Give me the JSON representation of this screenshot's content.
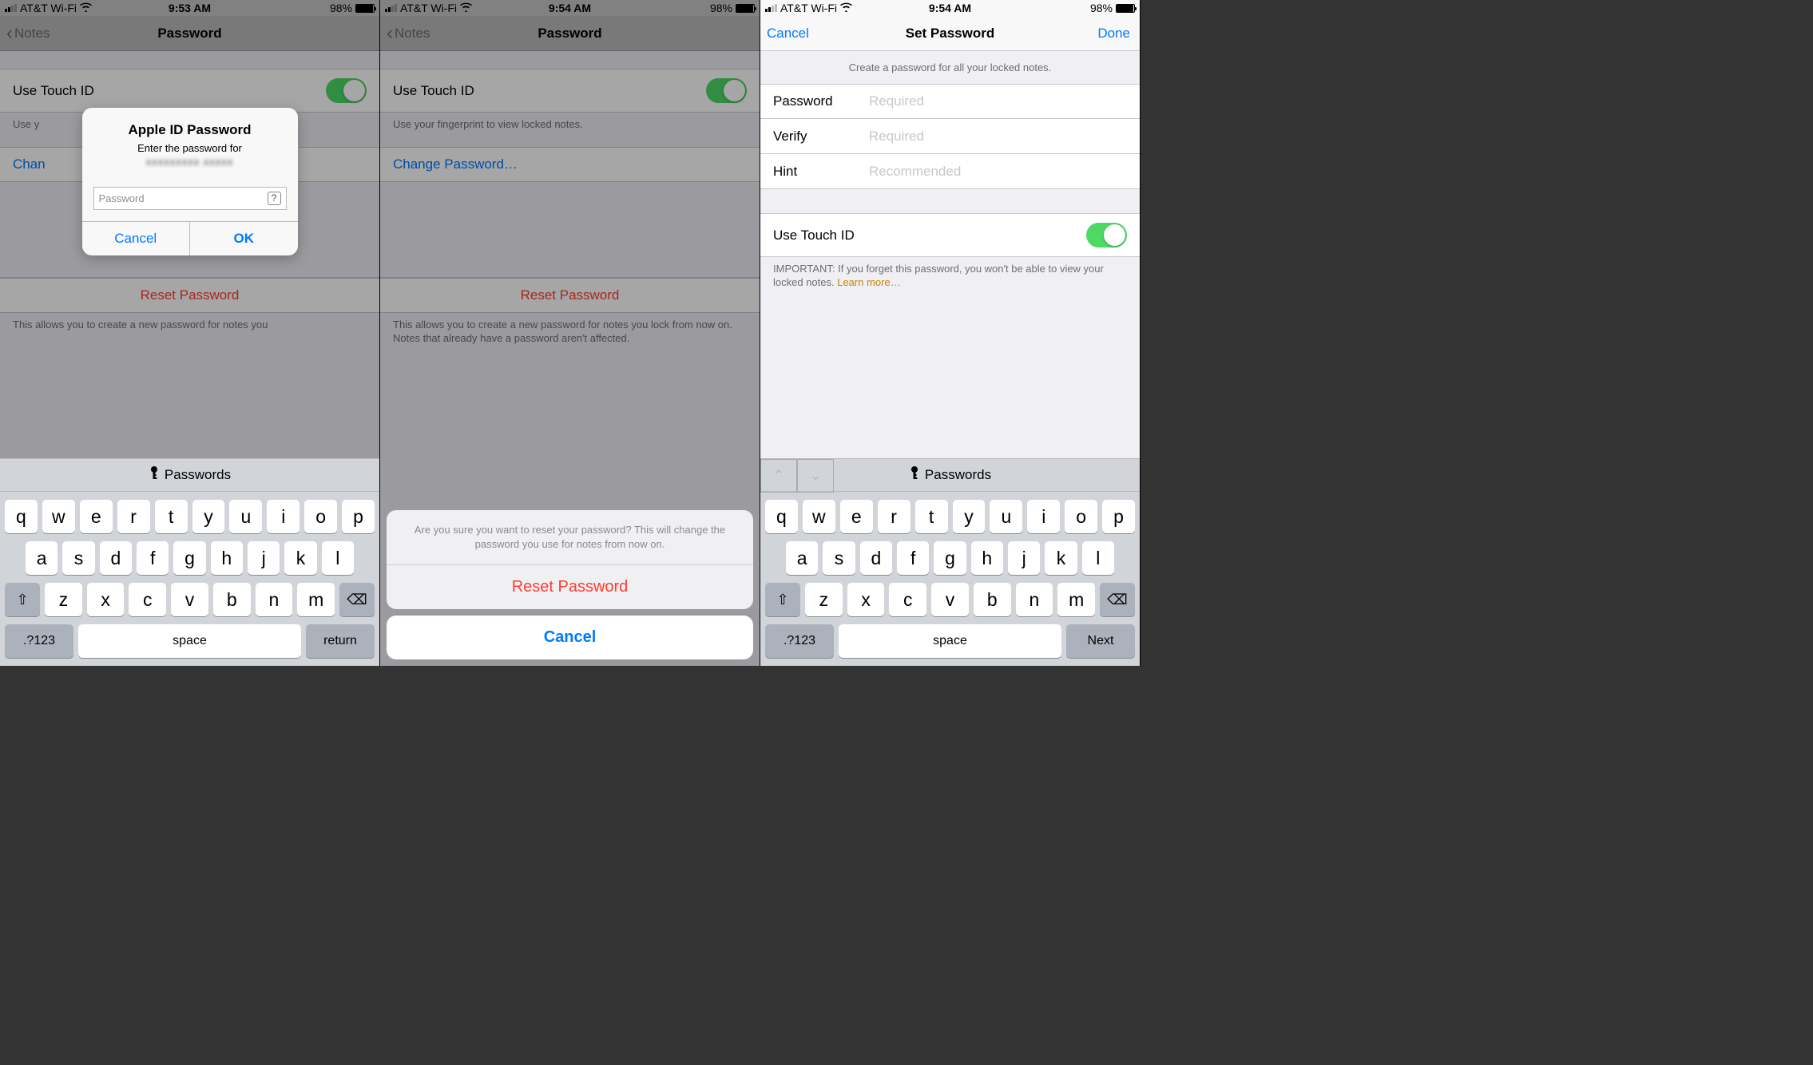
{
  "status": {
    "carrier": "AT&T Wi-Fi",
    "time1": "9:53 AM",
    "time2": "9:54 AM",
    "time3": "9:54 AM",
    "battery_pct": "98%"
  },
  "nav": {
    "back": "Notes",
    "title12": "Password",
    "title3": "Set Password",
    "cancel": "Cancel",
    "done": "Done"
  },
  "settings": {
    "touchid_label": "Use Touch ID",
    "touchid_footer": "Use your fingerprint to view locked notes.",
    "touchid_footer_short": "Use y",
    "change_pw": "Change Password…",
    "change_pw_short": "Chan",
    "reset_pw": "Reset Password",
    "reset_footer": "This allows you to create a new password for notes you lock from now on. Notes that already have a password aren't affected.",
    "reset_footer_trunc": "This allows you to create a new password for notes you"
  },
  "alert": {
    "title": "Apple ID Password",
    "message": "Enter the password for",
    "placeholder": "Password",
    "cancel": "Cancel",
    "ok": "OK"
  },
  "sheet": {
    "message": "Are you sure you want to reset your password? This will change the password you use for notes from now on.",
    "action": "Reset Password",
    "cancel": "Cancel"
  },
  "form": {
    "header": "Create a password for all your locked notes.",
    "password_label": "Password",
    "password_ph": "Required",
    "verify_label": "Verify",
    "verify_ph": "Required",
    "hint_label": "Hint",
    "hint_ph": "Recommended",
    "important": "IMPORTANT: If you forget this password, you won't be able to view your locked notes. ",
    "learn_more": "Learn more…"
  },
  "keyboard": {
    "passwords": "Passwords",
    "row1": [
      "q",
      "w",
      "e",
      "r",
      "t",
      "y",
      "u",
      "i",
      "o",
      "p"
    ],
    "row2": [
      "a",
      "s",
      "d",
      "f",
      "g",
      "h",
      "j",
      "k",
      "l"
    ],
    "row3": [
      "z",
      "x",
      "c",
      "v",
      "b",
      "n",
      "m"
    ],
    "numkey": ".?123",
    "space": "space",
    "return": "return",
    "next": "Next"
  }
}
